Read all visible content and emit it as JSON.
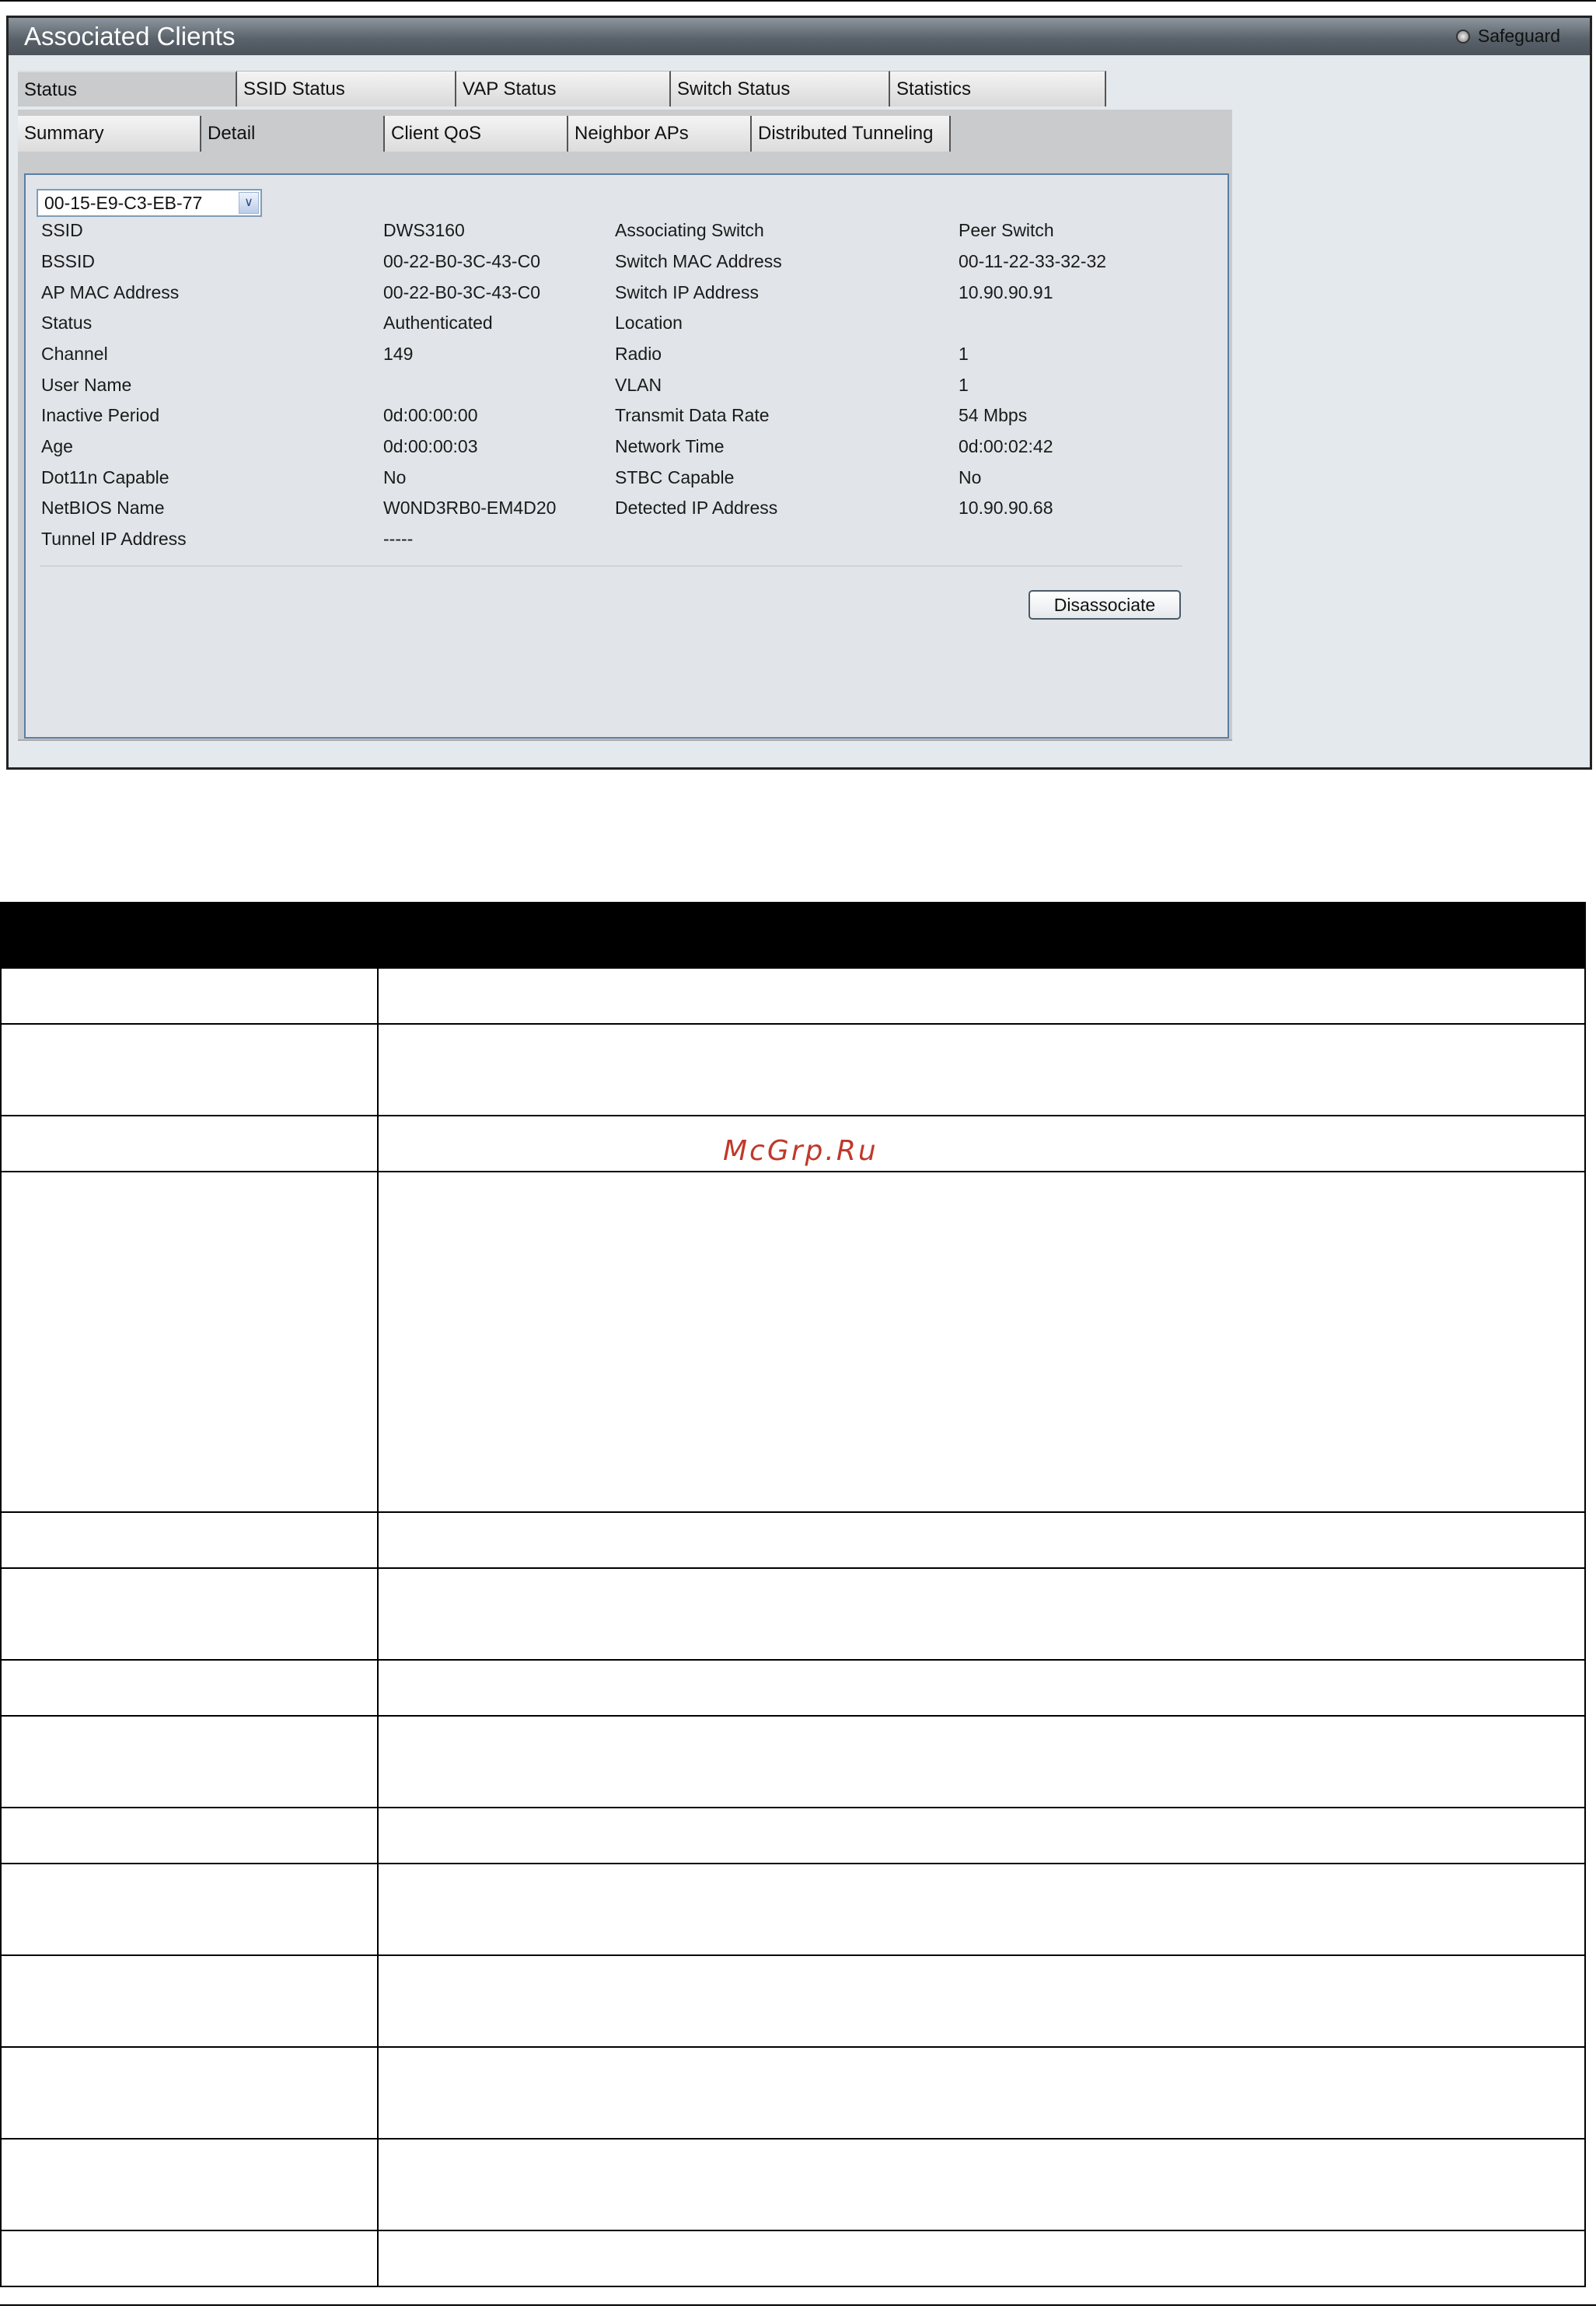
{
  "window": {
    "title": "Associated Clients",
    "safeguard_label": "Safeguard"
  },
  "tabs": {
    "top": [
      "Status",
      "SSID Status",
      "VAP Status",
      "Switch Status",
      "Statistics"
    ],
    "top_active": "Status",
    "sub": [
      "Summary",
      "Detail",
      "Client QoS",
      "Neighbor APs",
      "Distributed Tunneling"
    ],
    "sub_active": "Detail"
  },
  "client_select": {
    "value": "00-15-E9-C3-EB-77"
  },
  "details_left": [
    {
      "label": "SSID",
      "value": "DWS3160"
    },
    {
      "label": "BSSID",
      "value": "00-22-B0-3C-43-C0"
    },
    {
      "label": "AP MAC Address",
      "value": "00-22-B0-3C-43-C0"
    },
    {
      "label": "Status",
      "value": "Authenticated"
    },
    {
      "label": "Channel",
      "value": "149"
    },
    {
      "label": "User Name",
      "value": ""
    },
    {
      "label": "Inactive Period",
      "value": "0d:00:00:00"
    },
    {
      "label": "Age",
      "value": "0d:00:00:03"
    },
    {
      "label": "Dot11n Capable",
      "value": "No"
    },
    {
      "label": "NetBIOS Name",
      "value": "W0ND3RB0-EM4D20"
    },
    {
      "label": "Tunnel IP Address",
      "value": "-----"
    }
  ],
  "details_right": [
    {
      "label": "Associating Switch",
      "value": "Peer Switch"
    },
    {
      "label": "Switch MAC Address",
      "value": "00-11-22-33-32-32"
    },
    {
      "label": "Switch IP Address",
      "value": "10.90.90.91"
    },
    {
      "label": "Location",
      "value": ""
    },
    {
      "label": "Radio",
      "value": "1"
    },
    {
      "label": "VLAN",
      "value": "1"
    },
    {
      "label": "Transmit Data Rate",
      "value": "54 Mbps"
    },
    {
      "label": "Network Time",
      "value": "0d:00:02:42"
    },
    {
      "label": "STBC Capable",
      "value": "No"
    },
    {
      "label": "Detected IP Address",
      "value": "10.90.90.68"
    }
  ],
  "buttons": {
    "disassociate": "Disassociate"
  },
  "param_table": {
    "header": [
      "",
      ""
    ],
    "rows": [
      [
        "",
        ""
      ],
      [
        "",
        ""
      ],
      [
        "",
        ""
      ],
      [
        "",
        ""
      ],
      [
        "",
        ""
      ],
      [
        "",
        ""
      ],
      [
        "",
        ""
      ],
      [
        "",
        ""
      ],
      [
        "",
        ""
      ],
      [
        "",
        ""
      ],
      [
        "",
        ""
      ],
      [
        "",
        ""
      ],
      [
        "",
        ""
      ],
      [
        "",
        ""
      ]
    ]
  },
  "watermark": "McGrp.Ru",
  "colors": {
    "titlebar": "#5a626b",
    "tab_panel": "#c9cbcd",
    "content_bg": "#e1e5e9",
    "content_border": "#5a7ea5",
    "table_header": "#000000",
    "watermark": "#c0392b"
  }
}
